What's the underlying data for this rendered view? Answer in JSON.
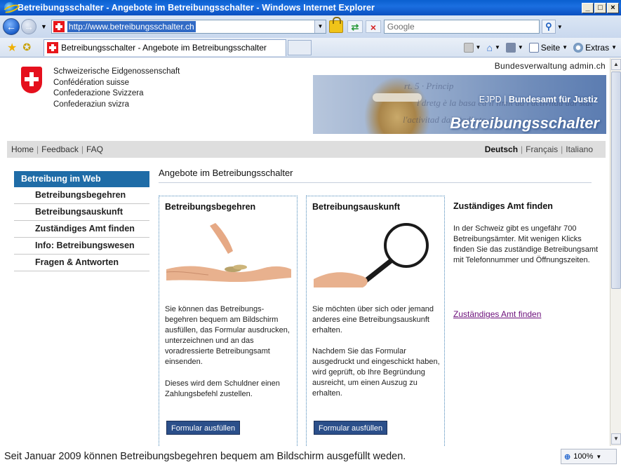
{
  "window": {
    "title": "Betreibungsschalter - Angebote im Betreibungsschalter - Windows Internet Explorer",
    "minimize": "_",
    "maximize": "□",
    "close": "×"
  },
  "address": {
    "url": "http://www.betreibungsschalter.ch",
    "search_placeholder": "Google"
  },
  "tab": {
    "label": "Betreibungsschalter - Angebote im Betreibungsschalter"
  },
  "commands": {
    "page": "Seite",
    "tools": "Extras"
  },
  "header": {
    "confed_lines": [
      "Schweizerische Eidgenossenschaft",
      "Confédération suisse",
      "Confederazione Svizzera",
      "Confederaziun svizra"
    ],
    "admin": "Bundesverwaltung admin.ch",
    "ejpd_prefix": "EJPD | ",
    "ejpd_bold": "Bundesamt für Justiz",
    "site_title": "Betreibungsschalter"
  },
  "linkbar": {
    "home": "Home",
    "feedback": "Feedback",
    "faq": "FAQ",
    "lang_de": "Deutsch",
    "lang_fr": "Français",
    "lang_it": "Italiano"
  },
  "nav": {
    "head": "Betreibung im Web",
    "items": [
      "Betreibungsbegehren",
      "Betreibungsauskunft",
      "Zuständiges Amt finden",
      "Info: Betreibungswesen",
      "Fragen & Antworten"
    ]
  },
  "main": {
    "title": "Angebote im Betreibungsschalter",
    "box1": {
      "heading": "Betreibungsbegehren",
      "para1": "Sie können das Betreibungs-begehren bequem am Bildschirm ausfüllen, das Formular ausdrucken, unterzeichnen und an das voradressierte Betreibungsamt einsenden.",
      "para2": "Dieses wird dem Schuldner einen Zahlungsbefehl zustellen.",
      "button": "Formular ausfüllen"
    },
    "box2": {
      "heading": "Betreibungsauskunft",
      "para1": "Sie möchten über sich oder jemand anderes eine Betreibungsauskunft erhalten.",
      "para2": "Nachdem Sie das Formular ausgedruckt und eingeschickt haben, wird geprüft, ob Ihre Begründung ausreicht, um einen Auszug zu erhalten.",
      "button": "Formular ausfüllen"
    },
    "col3": {
      "heading": "Zuständiges Amt finden",
      "text": "In der Schweiz gibt es ungefähr 700 Betreibungsämter. Mit wenigen Klicks finden Sie das zuständige Betreibungsamt mit Telefonnummer und Öffnungszeiten.",
      "link": "Zuständiges Amt finden"
    }
  },
  "status": {
    "text": "Seit Januar 2009 können Betreibungsbegehren bequem am Bildschirm ausgefüllt weden.",
    "zoom": "100%"
  }
}
